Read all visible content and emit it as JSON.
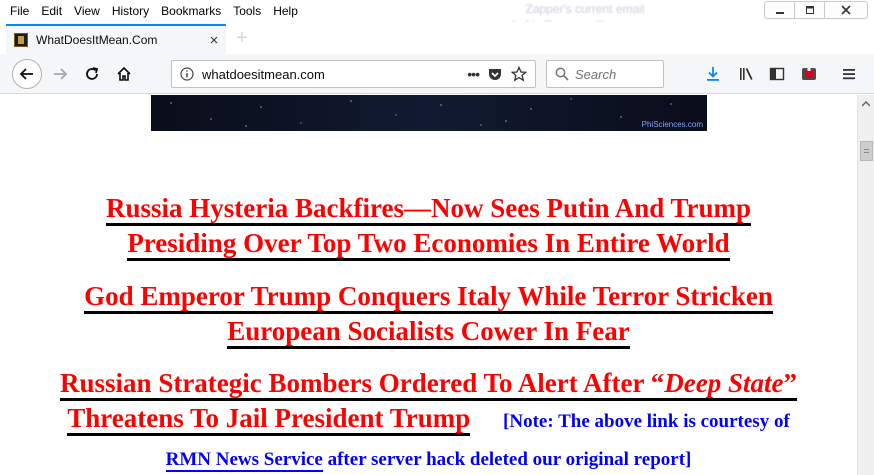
{
  "window": {
    "menu": [
      "File",
      "Edit",
      "View",
      "History",
      "Bookmarks",
      "Tools",
      "Help"
    ],
    "ghost_line1": "Zapper's current email",
    "ghost_line2": "hubie@rumormillnews.com"
  },
  "tab": {
    "title": "WhatDoesItMean.Com",
    "close": "×",
    "new_tab": "+"
  },
  "navbar": {
    "url": "whatdoesitmean.com",
    "page_actions": "•••",
    "search_placeholder": "Search"
  },
  "banner": {
    "credit": "PhiSciences.com"
  },
  "headlines": [
    {
      "line1": "Russia Hysteria Backfires—Now Sees Putin And Trump",
      "line2": "Presiding Over Top Two Economies In Entire World"
    },
    {
      "line1": "God Emperor Trump Conquers Italy While Terror Stricken",
      "line2": "European Socialists Cower In Fear"
    },
    {
      "line1_pre": "Russian Strategic Bombers Ordered To Alert After “",
      "line1_em": "Deep State",
      "line1_post": "”",
      "line2": "Threatens To Jail President Trump"
    }
  ],
  "note": {
    "part1": "[Note: The above link is courtesy of",
    "link": "RMN News Service",
    "part2": "after server hack deleted our original report]"
  },
  "colors": {
    "headline": "#ff0000",
    "note": "#0000ff",
    "tab_accent": "#0a84ff",
    "download_icon": "#0a84ff"
  }
}
